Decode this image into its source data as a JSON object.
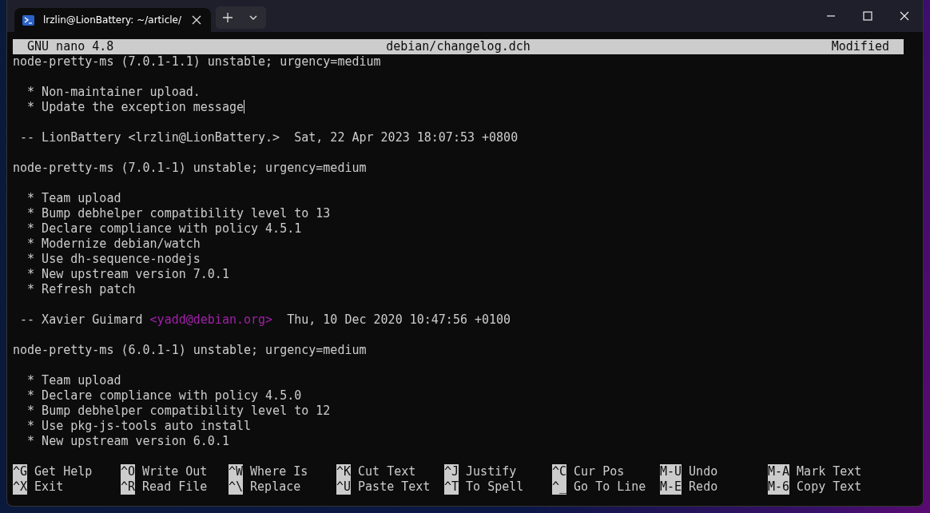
{
  "window": {
    "tab_title": "lrzlin@LionBattery: ~/article/"
  },
  "nano": {
    "version": "GNU nano 4.8",
    "file": "debian/changelog.dch",
    "status": "Modified"
  },
  "lines": [
    {
      "kind": "text",
      "text": "node-pretty-ms (7.0.1-1.1) unstable; urgency=medium"
    },
    {
      "kind": "blank"
    },
    {
      "kind": "text",
      "text": "  * Non-maintainer upload."
    },
    {
      "kind": "text",
      "text": "  * Update the exception message",
      "cursor": true
    },
    {
      "kind": "blank"
    },
    {
      "kind": "signature",
      "name": " -- LionBattery ",
      "email": "<lrzlin@LionBattery.>",
      "email_highlighted": false,
      "date": "  Sat, 22 Apr 2023 18:07:53 +0800"
    },
    {
      "kind": "blank"
    },
    {
      "kind": "text",
      "text": "node-pretty-ms (7.0.1-1) unstable; urgency=medium"
    },
    {
      "kind": "blank"
    },
    {
      "kind": "text",
      "text": "  * Team upload"
    },
    {
      "kind": "text",
      "text": "  * Bump debhelper compatibility level to 13"
    },
    {
      "kind": "text",
      "text": "  * Declare compliance with policy 4.5.1"
    },
    {
      "kind": "text",
      "text": "  * Modernize debian/watch"
    },
    {
      "kind": "text",
      "text": "  * Use dh-sequence-nodejs"
    },
    {
      "kind": "text",
      "text": "  * New upstream version 7.0.1"
    },
    {
      "kind": "text",
      "text": "  * Refresh patch"
    },
    {
      "kind": "blank"
    },
    {
      "kind": "signature",
      "name": " -- Xavier Guimard ",
      "email": "<yadd@debian.org>",
      "email_highlighted": true,
      "date": "  Thu, 10 Dec 2020 10:47:56 +0100"
    },
    {
      "kind": "blank"
    },
    {
      "kind": "text",
      "text": "node-pretty-ms (6.0.1-1) unstable; urgency=medium"
    },
    {
      "kind": "blank"
    },
    {
      "kind": "text",
      "text": "  * Team upload"
    },
    {
      "kind": "text",
      "text": "  * Declare compliance with policy 4.5.0"
    },
    {
      "kind": "text",
      "text": "  * Bump debhelper compatibility level to 12"
    },
    {
      "kind": "text",
      "text": "  * Use pkg-js-tools auto install"
    },
    {
      "kind": "text",
      "text": "  * New upstream version 6.0.1"
    },
    {
      "kind": "blank"
    }
  ],
  "shortcuts": [
    [
      {
        "key": "^G",
        "label": "Get Help"
      },
      {
        "key": "^X",
        "label": "Exit"
      }
    ],
    [
      {
        "key": "^O",
        "label": "Write Out"
      },
      {
        "key": "^R",
        "label": "Read File"
      }
    ],
    [
      {
        "key": "^W",
        "label": "Where Is"
      },
      {
        "key": "^\\",
        "label": "Replace"
      }
    ],
    [
      {
        "key": "^K",
        "label": "Cut Text"
      },
      {
        "key": "^U",
        "label": "Paste Text"
      }
    ],
    [
      {
        "key": "^J",
        "label": "Justify"
      },
      {
        "key": "^T",
        "label": "To Spell"
      }
    ],
    [
      {
        "key": "^C",
        "label": "Cur Pos"
      },
      {
        "key": "^_",
        "label": "Go To Line"
      }
    ],
    [
      {
        "key": "M-U",
        "label": "Undo"
      },
      {
        "key": "M-E",
        "label": "Redo"
      }
    ],
    [
      {
        "key": "M-A",
        "label": "Mark Text"
      },
      {
        "key": "M-6",
        "label": "Copy Text"
      }
    ]
  ]
}
